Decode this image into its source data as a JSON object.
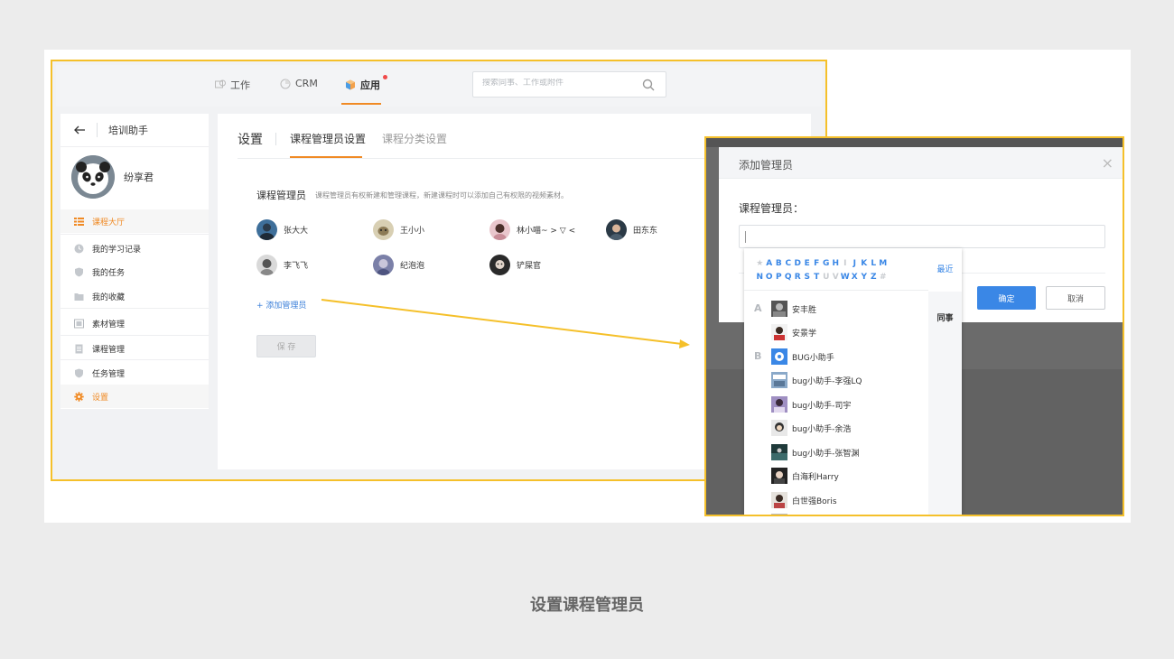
{
  "topnav": {
    "tabs": [
      {
        "label": "工作",
        "icon": "work-icon"
      },
      {
        "label": "CRM",
        "icon": "crm-icon"
      },
      {
        "label": "应用",
        "icon": "apps-cube-icon"
      }
    ],
    "search_placeholder": "搜索同事、工作或附件"
  },
  "sidebar": {
    "title": "培训助手",
    "username": "纷享君",
    "items": [
      {
        "label": "课程大厅",
        "icon": "list-icon"
      },
      {
        "label": "我的学习记录",
        "icon": "clock-icon"
      },
      {
        "label": "我的任务",
        "icon": "shield-icon"
      },
      {
        "label": "我的收藏",
        "icon": "folder-icon"
      },
      {
        "label": "素材管理",
        "icon": "media-icon"
      },
      {
        "label": "课程管理",
        "icon": "doc-icon"
      },
      {
        "label": "任务管理",
        "icon": "shield-icon"
      },
      {
        "label": "设置",
        "icon": "gear-icon"
      }
    ]
  },
  "content": {
    "title": "设置",
    "tabs": [
      "课程管理员设置",
      "课程分类设置"
    ],
    "section_label": "课程管理员",
    "section_desc": "课程管理员有权新建和管理课程，新建课程时可以添加自己有权限的视频素材。",
    "members": [
      "张大大",
      "王小小",
      "林小喵~ > ▽ <",
      "田东东",
      "李飞飞",
      "纪泡泡",
      "铲屎官"
    ],
    "add_link": "+ 添加管理员",
    "save_label": "保 存"
  },
  "modal": {
    "title": "添加管理员",
    "close_glyph": "×",
    "field_label": "课程管理员：",
    "ok_label": "确定",
    "cancel_label": "取消",
    "letters_row1": [
      "★",
      "A",
      "B",
      "C",
      "D",
      "E",
      "F",
      "G",
      "H",
      "I",
      "J",
      "K",
      "L",
      "M"
    ],
    "letters_row2": [
      "N",
      "O",
      "P",
      "Q",
      "R",
      "S",
      "T",
      "U",
      "V",
      "W",
      "X",
      "Y",
      "Z",
      "#"
    ],
    "side_tabs": [
      "最近",
      "同事"
    ],
    "groups": [
      {
        "letter": "A",
        "people": [
          "安丰胜",
          "安景学"
        ]
      },
      {
        "letter": "B",
        "people": [
          "BUG小助手",
          "bug小助手-李强LQ",
          "bug小助手-司宇",
          "bug小助手-余浩",
          "bug小助手-张智渊",
          "白海利Harry",
          "白世强Boris"
        ]
      }
    ]
  },
  "caption": "设置课程管理员",
  "colors": {
    "accent_orange": "#f08a24",
    "link_blue": "#3a87e6",
    "frame_yellow": "#f5c02a"
  }
}
